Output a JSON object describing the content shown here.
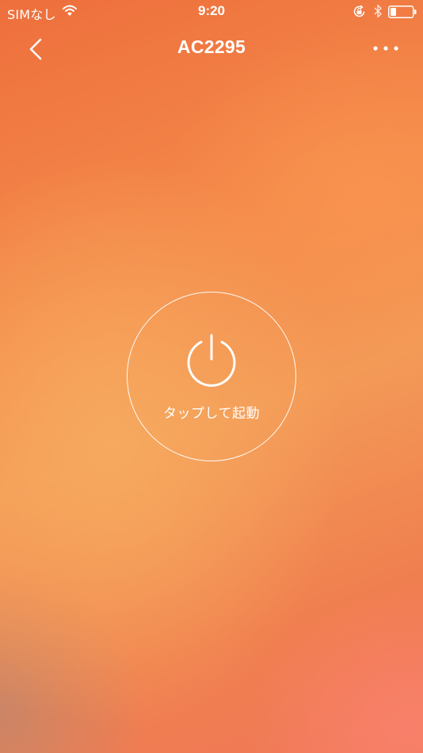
{
  "status_bar": {
    "carrier": "SIMなし",
    "time": "9:20",
    "icons": [
      "wifi-icon",
      "rotation-lock-icon",
      "bluetooth-icon",
      "battery-icon"
    ]
  },
  "nav": {
    "title": "AC2295",
    "back_icon": "chevron-left-icon",
    "more_icon": "more-horizontal-icon"
  },
  "power": {
    "icon": "power-icon",
    "label": "タップして起動"
  },
  "colors": {
    "background_primary": "#f48a4b",
    "background_light": "#f7aa5f",
    "background_accent": "#fa826e",
    "foreground": "#ffffff"
  }
}
